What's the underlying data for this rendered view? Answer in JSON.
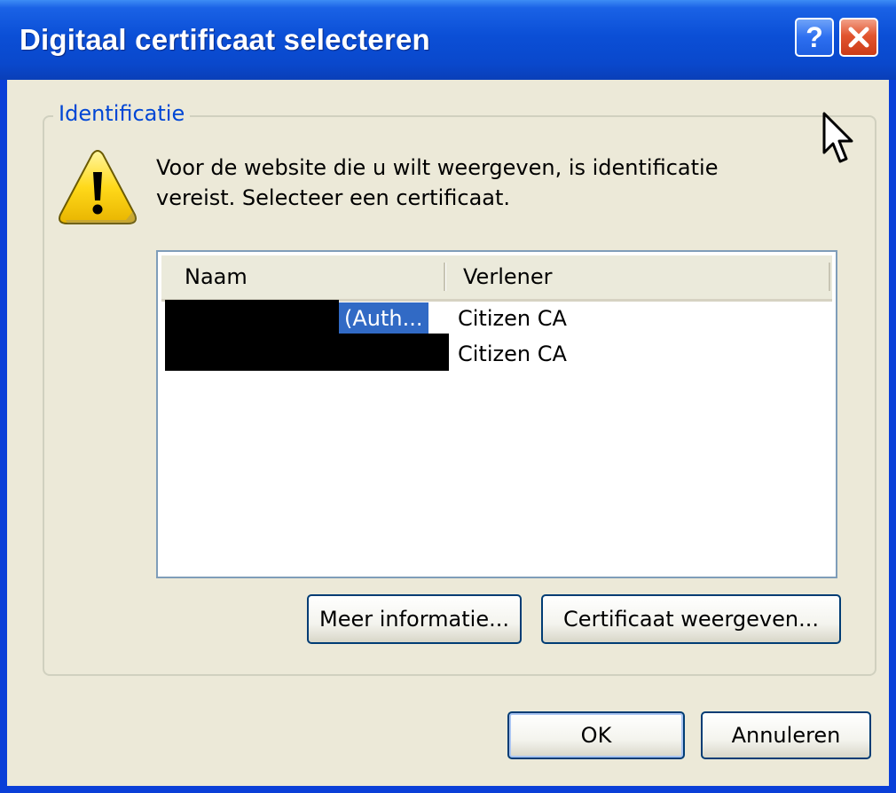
{
  "window": {
    "title": "Digitaal certificaat selecteren",
    "help_label": "?",
    "accent_color": "#0a4fd6"
  },
  "group": {
    "label": "Identificatie"
  },
  "message": {
    "line1": "Voor de website die u wilt weergeven, is identificatie",
    "line2": "vereist. Selecteer een certificaat."
  },
  "list": {
    "columns": [
      "Naam",
      "Verlener"
    ],
    "rows": [
      {
        "name_visible": "(Auth...",
        "issuer": "Citizen CA",
        "selected": true,
        "name_redacted": true
      },
      {
        "name_visible": "",
        "issuer": "Citizen CA",
        "selected": false,
        "name_redacted": true
      }
    ]
  },
  "buttons": {
    "more_info": "Meer informatie...",
    "view_cert": "Certificaat weergeven...",
    "ok": "OK",
    "cancel": "Annuleren"
  },
  "icons": {
    "warning": "warning-icon",
    "help": "help-icon",
    "close": "close-icon",
    "cursor": "mouse-cursor-icon"
  }
}
